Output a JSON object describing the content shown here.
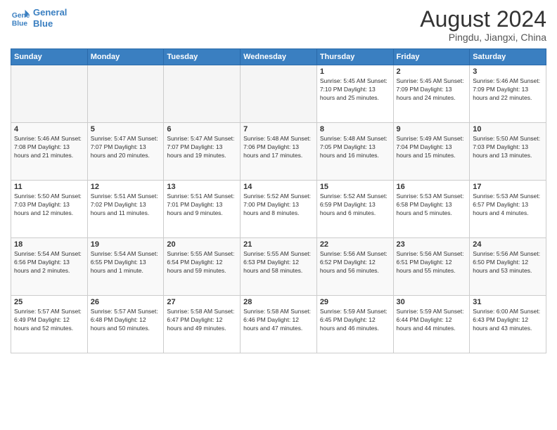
{
  "logo": {
    "line1": "General",
    "line2": "Blue"
  },
  "title": "August 2024",
  "subtitle": "Pingdu, Jiangxi, China",
  "weekdays": [
    "Sunday",
    "Monday",
    "Tuesday",
    "Wednesday",
    "Thursday",
    "Friday",
    "Saturday"
  ],
  "weeks": [
    [
      {
        "day": "",
        "info": ""
      },
      {
        "day": "",
        "info": ""
      },
      {
        "day": "",
        "info": ""
      },
      {
        "day": "",
        "info": ""
      },
      {
        "day": "1",
        "info": "Sunrise: 5:45 AM\nSunset: 7:10 PM\nDaylight: 13 hours\nand 25 minutes."
      },
      {
        "day": "2",
        "info": "Sunrise: 5:45 AM\nSunset: 7:09 PM\nDaylight: 13 hours\nand 24 minutes."
      },
      {
        "day": "3",
        "info": "Sunrise: 5:46 AM\nSunset: 7:09 PM\nDaylight: 13 hours\nand 22 minutes."
      }
    ],
    [
      {
        "day": "4",
        "info": "Sunrise: 5:46 AM\nSunset: 7:08 PM\nDaylight: 13 hours\nand 21 minutes."
      },
      {
        "day": "5",
        "info": "Sunrise: 5:47 AM\nSunset: 7:07 PM\nDaylight: 13 hours\nand 20 minutes."
      },
      {
        "day": "6",
        "info": "Sunrise: 5:47 AM\nSunset: 7:07 PM\nDaylight: 13 hours\nand 19 minutes."
      },
      {
        "day": "7",
        "info": "Sunrise: 5:48 AM\nSunset: 7:06 PM\nDaylight: 13 hours\nand 17 minutes."
      },
      {
        "day": "8",
        "info": "Sunrise: 5:48 AM\nSunset: 7:05 PM\nDaylight: 13 hours\nand 16 minutes."
      },
      {
        "day": "9",
        "info": "Sunrise: 5:49 AM\nSunset: 7:04 PM\nDaylight: 13 hours\nand 15 minutes."
      },
      {
        "day": "10",
        "info": "Sunrise: 5:50 AM\nSunset: 7:03 PM\nDaylight: 13 hours\nand 13 minutes."
      }
    ],
    [
      {
        "day": "11",
        "info": "Sunrise: 5:50 AM\nSunset: 7:03 PM\nDaylight: 13 hours\nand 12 minutes."
      },
      {
        "day": "12",
        "info": "Sunrise: 5:51 AM\nSunset: 7:02 PM\nDaylight: 13 hours\nand 11 minutes."
      },
      {
        "day": "13",
        "info": "Sunrise: 5:51 AM\nSunset: 7:01 PM\nDaylight: 13 hours\nand 9 minutes."
      },
      {
        "day": "14",
        "info": "Sunrise: 5:52 AM\nSunset: 7:00 PM\nDaylight: 13 hours\nand 8 minutes."
      },
      {
        "day": "15",
        "info": "Sunrise: 5:52 AM\nSunset: 6:59 PM\nDaylight: 13 hours\nand 6 minutes."
      },
      {
        "day": "16",
        "info": "Sunrise: 5:53 AM\nSunset: 6:58 PM\nDaylight: 13 hours\nand 5 minutes."
      },
      {
        "day": "17",
        "info": "Sunrise: 5:53 AM\nSunset: 6:57 PM\nDaylight: 13 hours\nand 4 minutes."
      }
    ],
    [
      {
        "day": "18",
        "info": "Sunrise: 5:54 AM\nSunset: 6:56 PM\nDaylight: 13 hours\nand 2 minutes."
      },
      {
        "day": "19",
        "info": "Sunrise: 5:54 AM\nSunset: 6:55 PM\nDaylight: 13 hours\nand 1 minute."
      },
      {
        "day": "20",
        "info": "Sunrise: 5:55 AM\nSunset: 6:54 PM\nDaylight: 12 hours\nand 59 minutes."
      },
      {
        "day": "21",
        "info": "Sunrise: 5:55 AM\nSunset: 6:53 PM\nDaylight: 12 hours\nand 58 minutes."
      },
      {
        "day": "22",
        "info": "Sunrise: 5:56 AM\nSunset: 6:52 PM\nDaylight: 12 hours\nand 56 minutes."
      },
      {
        "day": "23",
        "info": "Sunrise: 5:56 AM\nSunset: 6:51 PM\nDaylight: 12 hours\nand 55 minutes."
      },
      {
        "day": "24",
        "info": "Sunrise: 5:56 AM\nSunset: 6:50 PM\nDaylight: 12 hours\nand 53 minutes."
      }
    ],
    [
      {
        "day": "25",
        "info": "Sunrise: 5:57 AM\nSunset: 6:49 PM\nDaylight: 12 hours\nand 52 minutes."
      },
      {
        "day": "26",
        "info": "Sunrise: 5:57 AM\nSunset: 6:48 PM\nDaylight: 12 hours\nand 50 minutes."
      },
      {
        "day": "27",
        "info": "Sunrise: 5:58 AM\nSunset: 6:47 PM\nDaylight: 12 hours\nand 49 minutes."
      },
      {
        "day": "28",
        "info": "Sunrise: 5:58 AM\nSunset: 6:46 PM\nDaylight: 12 hours\nand 47 minutes."
      },
      {
        "day": "29",
        "info": "Sunrise: 5:59 AM\nSunset: 6:45 PM\nDaylight: 12 hours\nand 46 minutes."
      },
      {
        "day": "30",
        "info": "Sunrise: 5:59 AM\nSunset: 6:44 PM\nDaylight: 12 hours\nand 44 minutes."
      },
      {
        "day": "31",
        "info": "Sunrise: 6:00 AM\nSunset: 6:43 PM\nDaylight: 12 hours\nand 43 minutes."
      }
    ]
  ]
}
